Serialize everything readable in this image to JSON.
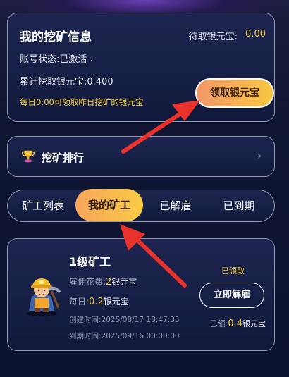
{
  "info": {
    "title": "我的挖矿信息",
    "pending_label": "待取银元宝:",
    "pending_value": "0.00",
    "status_text": "账号状态:已激活",
    "mined_text": "累计挖取银元宝:0.400",
    "notice": "每日0:00可领取昨日挖矿的银元宝",
    "claim_button": "领取银元宝"
  },
  "rank": {
    "label": "挖矿排行"
  },
  "tabs": [
    {
      "label": "矿工列表",
      "active": false
    },
    {
      "label": "我的矿工",
      "active": true
    },
    {
      "label": "已解雇",
      "active": false
    },
    {
      "label": "已到期",
      "active": false
    }
  ],
  "worker": {
    "title": "1级矿工",
    "fee_label": "雇佣花费:",
    "fee_value": "2",
    "fee_unit": "银元宝",
    "daily_label": "每日:",
    "daily_value": "0.2",
    "daily_unit": "银元宝",
    "created": "创建时间:2025/08/17 18:47:35",
    "expires": "到期时间:2025/09/16 00:00:00",
    "claimed_badge": "已领取",
    "fire_button": "立即解雇",
    "received_label": "已领:",
    "received_value": "0.4",
    "received_unit": "银元宝"
  },
  "colors": {
    "accent_yellow": "#f6cb3b",
    "button_gradient_start": "#f3976a",
    "button_gradient_end": "#f8c640",
    "arrow_red": "#e8322b",
    "card_border": "#ffffff"
  },
  "icons": [
    "trophy-icon",
    "chevron-right-icon",
    "miner-avatar-icon",
    "red-arrow"
  ]
}
